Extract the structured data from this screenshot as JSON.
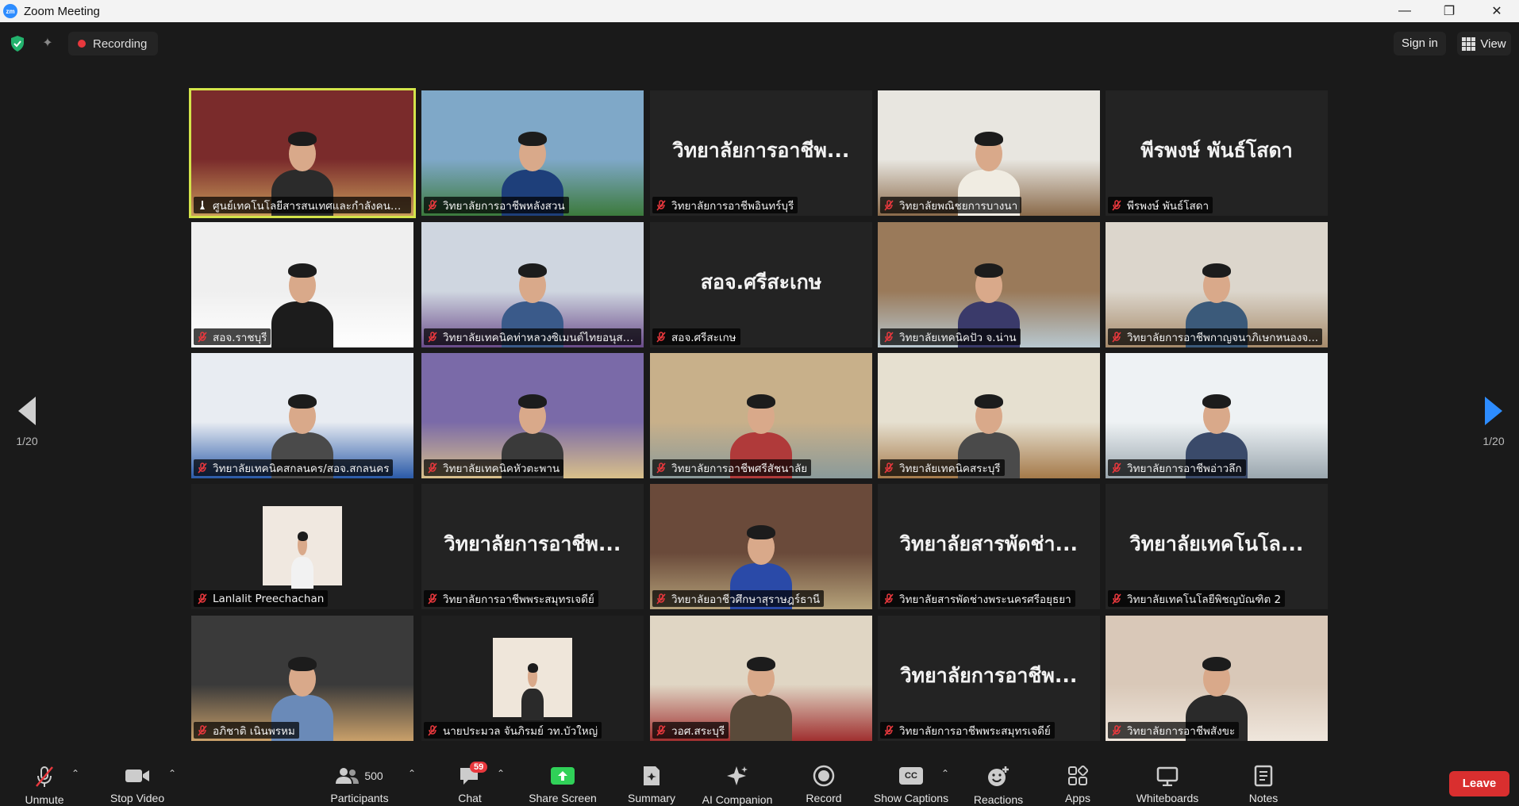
{
  "window": {
    "title": "Zoom Meeting",
    "app_icon_text": "zm",
    "minimize": "—",
    "restore": "❐",
    "close": "✕"
  },
  "topbar": {
    "recording_label": "Recording",
    "signin_label": "Sign in",
    "view_label": "View"
  },
  "pager": {
    "left": "1/20",
    "right": "1/20"
  },
  "tiles": [
    {
      "name": "ศูนย์เทคโนโลยีสารสนเทศและกำลังคนอา...",
      "big": "",
      "video": true,
      "active": true
    },
    {
      "name": "วิทยาลัยการอาชีพหลังสวน",
      "big": "",
      "video": true
    },
    {
      "name": "วิทยาลัยการอาชีพอินทร์บุรี",
      "big": "วิทยาลัยการอาชีพ...",
      "video": false
    },
    {
      "name": "วิทยาลัยพณิชยการบางนา",
      "big": "",
      "video": true
    },
    {
      "name": "พีรพงษ์ พันธ์โสดา",
      "big": "พีรพงษ์ พันธ์โสดา",
      "video": false
    },
    {
      "name": "สอจ.ราชบุรี",
      "big": "",
      "video": true
    },
    {
      "name": "วิทยาลัยเทคนิคท่าหลวงซิเมนต์ไทยอนุสร...",
      "big": "",
      "video": true
    },
    {
      "name": "สอจ.ศรีสะเกษ",
      "big": "สอจ.ศรีสะเกษ",
      "video": false
    },
    {
      "name": "วิทยาลัยเทคนิคปัว จ.น่าน",
      "big": "",
      "video": true
    },
    {
      "name": "วิทยาลัยการอาชีพกาญจนาภิเษกหนองจ...",
      "big": "",
      "video": true
    },
    {
      "name": "วิทยาลัยเทคนิคสกลนคร/สอจ.สกลนคร",
      "big": "",
      "video": true
    },
    {
      "name": "วิทยาลัยเทคนิคหัวตะพาน",
      "big": "",
      "video": true
    },
    {
      "name": "วิทยาลัยการอาชีพศรีสัชนาลัย",
      "big": "",
      "video": true
    },
    {
      "name": "วิทยาลัยเทคนิคสระบุรี",
      "big": "",
      "video": true
    },
    {
      "name": "วิทยาลัยการอาชีพอ่าวลึก",
      "big": "",
      "video": true
    },
    {
      "name": "Lanlalit Preechachan",
      "big": "",
      "video": true
    },
    {
      "name": "วิทยาลัยการอาชีพพระสมุทรเจดีย์",
      "big": "วิทยาลัยการอาชีพ...",
      "video": false
    },
    {
      "name": "วิทยาลัยอาชีวศึกษาสุราษฎร์ธานี",
      "big": "",
      "video": true
    },
    {
      "name": "วิทยาลัยสารพัดช่างพระนครศรีอยุธยา",
      "big": "วิทยาลัยสารพัดช่า...",
      "video": false
    },
    {
      "name": "วิทยาลัยเทคโนโลยีพิชญบัณฑิต 2",
      "big": "วิทยาลัยเทคโนโล...",
      "video": false
    },
    {
      "name": "อภิชาติ เนินพรหม",
      "big": "",
      "video": true
    },
    {
      "name": "นายประมวล จันภิรมย์ วท.บัวใหญ่",
      "big": "",
      "video": true
    },
    {
      "name": "วอศ.สระบุรี",
      "big": "",
      "video": true
    },
    {
      "name": "วิทยาลัยการอาชีพพระสมุทรเจดีย์",
      "big": "วิทยาลัยการอาชีพ...",
      "video": false
    },
    {
      "name": "วิทยาลัยการอาชีพสังขะ",
      "big": "",
      "video": true
    }
  ],
  "toolbar": {
    "unmute": "Unmute",
    "stop_video": "Stop Video",
    "participants": "Participants",
    "participants_count": "500",
    "chat": "Chat",
    "chat_badge": "59",
    "share_screen": "Share Screen",
    "summary": "Summary",
    "ai_companion": "AI Companion",
    "record": "Record",
    "show_captions": "Show Captions",
    "captions_icon_text": "CC",
    "reactions": "Reactions",
    "apps": "Apps",
    "whiteboards": "Whiteboards",
    "notes": "Notes",
    "leave": "Leave"
  },
  "colors": {
    "background": "#1a1a1a",
    "tile": "#232323",
    "active_speaker": "#d4e44a",
    "share_green": "#30d158",
    "leave_red": "#d92f2f",
    "muted_red": "#e8383d",
    "accent_blue": "#2d8cff"
  },
  "icons": {
    "security": "shield-icon",
    "muted": "mic-off-icon",
    "video": "video-camera-icon",
    "participants": "people-icon",
    "chat": "chat-bubble-icon",
    "share": "share-screen-icon",
    "summary": "summary-icon",
    "ai": "sparkle-icon",
    "record": "record-icon",
    "captions": "cc-icon",
    "reactions": "emoji-icon",
    "apps": "apps-icon",
    "whiteboards": "whiteboard-icon",
    "notes": "notes-icon"
  }
}
